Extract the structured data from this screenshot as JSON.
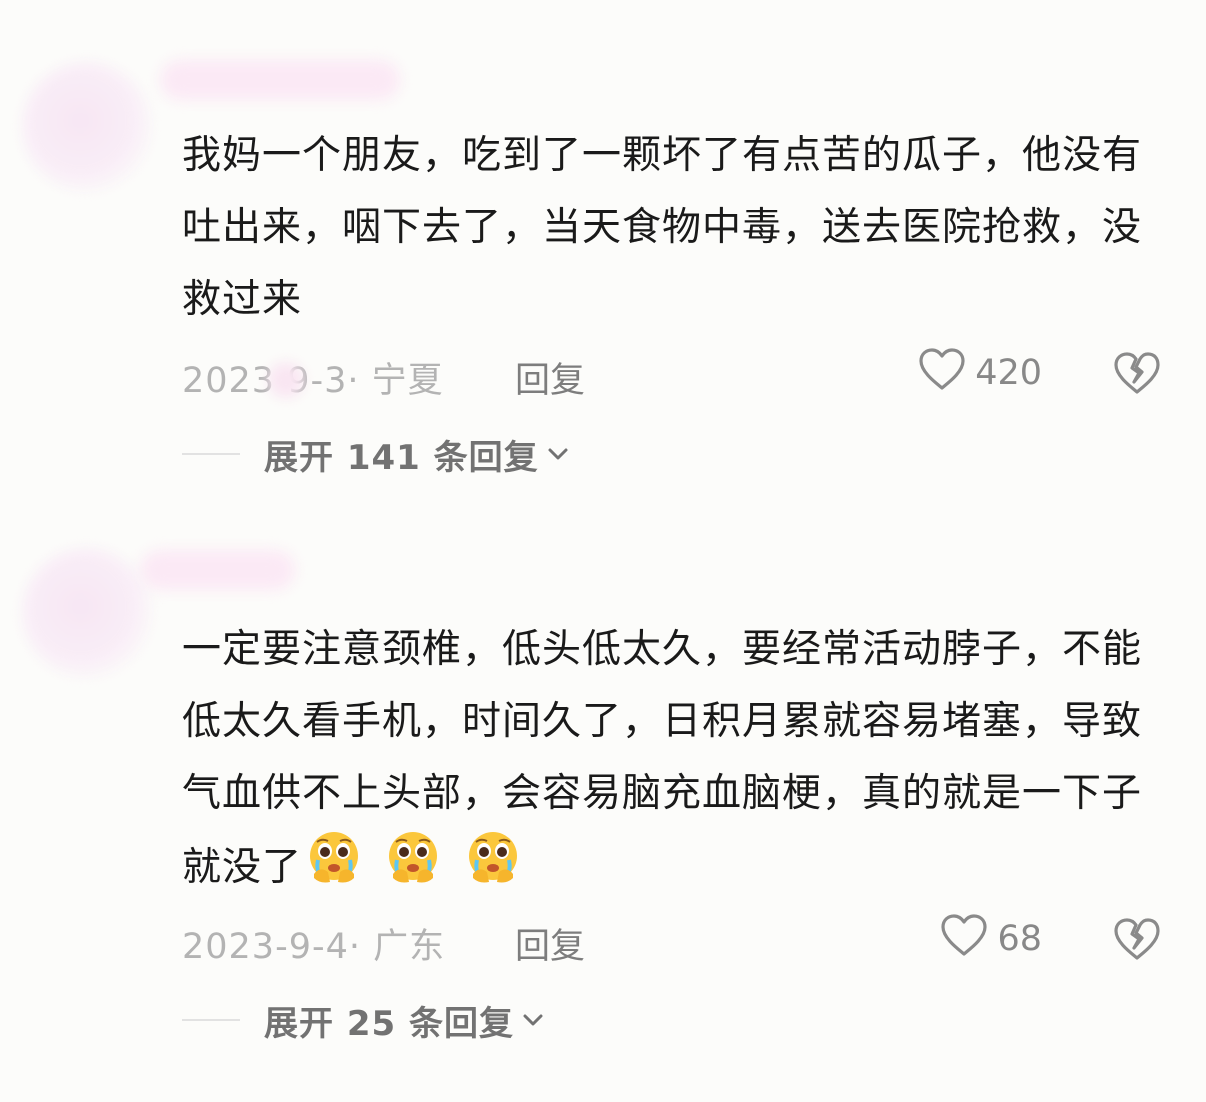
{
  "comments": [
    {
      "text": "我妈一个朋友，吃到了一颗坏了有点苦的瓜子，他没有吐出来，咽下去了，当天食物中毒，送去医院抢救，没救过来",
      "date_location": "2023  9-3· 宁夏",
      "reply_label": "回复",
      "like_count": "420",
      "expand_label": "展开 141 条回复",
      "emojis": []
    },
    {
      "text": "一定要注意颈椎，低头低太久，要经常活动脖子，不能低太久看手机，时间久了，日积月累就容易堵塞，导致气血供不上头部，会容易脑充血脑梗，真的就是一下子就没了",
      "date_location": "2023-9-4· 广东",
      "reply_label": "回复",
      "like_count": "68",
      "expand_label": "展开 25 条回复",
      "emojis": [
        "pleading-crying-emoji",
        "pleading-crying-emoji",
        "pleading-crying-emoji"
      ]
    }
  ],
  "icons": {
    "like": "heart-outline-icon",
    "dislike": "broken-heart-icon",
    "expand": "chevron-down-icon"
  },
  "colors": {
    "background": "#fcfcfa",
    "text": "#1a1a1a",
    "meta": "#b3b3b3",
    "reply": "#7d7d7d",
    "expand": "#727272"
  }
}
